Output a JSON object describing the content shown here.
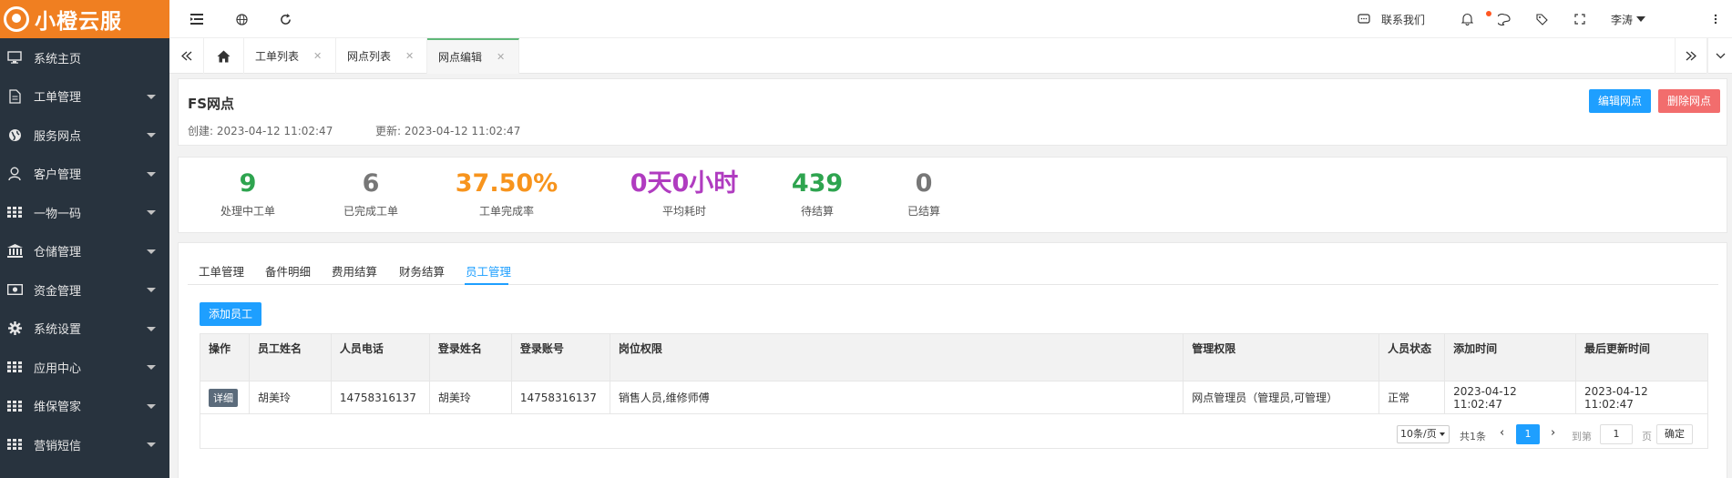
{
  "brand": {
    "name": "小橙云服",
    "color": "#f07f21"
  },
  "sidebar": {
    "items": [
      {
        "label": "系统主页",
        "icon": "monitor-icon",
        "has_caret": false
      },
      {
        "label": "工单管理",
        "icon": "document-icon",
        "has_caret": true
      },
      {
        "label": "服务网点",
        "icon": "globe-icon",
        "has_caret": true
      },
      {
        "label": "客户管理",
        "icon": "user-icon",
        "has_caret": true
      },
      {
        "label": "一物一码",
        "icon": "grid-icon",
        "has_caret": true
      },
      {
        "label": "仓储管理",
        "icon": "bank-icon",
        "has_caret": true
      },
      {
        "label": "资金管理",
        "icon": "money-icon",
        "has_caret": true
      },
      {
        "label": "系统设置",
        "icon": "gear-icon",
        "has_caret": true
      },
      {
        "label": "应用中心",
        "icon": "grid-icon",
        "has_caret": true
      },
      {
        "label": "维保管家",
        "icon": "grid-icon",
        "has_caret": true
      },
      {
        "label": "营销短信",
        "icon": "grid-icon",
        "has_caret": true
      }
    ]
  },
  "topbar": {
    "contact": "联系我们",
    "user": "李涛"
  },
  "tabs": [
    {
      "label": "工单列表"
    },
    {
      "label": "网点列表"
    },
    {
      "label": "网点编辑"
    }
  ],
  "header": {
    "title": "FS网点",
    "created_label": "创建:",
    "created": "2023-04-12 11:02:47",
    "updated_label": "更新:",
    "updated": "2023-04-12 11:02:47",
    "edit_button": "编辑网点",
    "delete_button": "删除网点"
  },
  "stats": [
    {
      "value": "9",
      "label": "处理中工单",
      "color": "#2ea44f"
    },
    {
      "value": "6",
      "label": "已完成工单",
      "color": "#777777"
    },
    {
      "value": "37.50%",
      "label": "工单完成率",
      "color": "#f7941d"
    },
    {
      "value": "0天0小时",
      "label": "平均耗时",
      "color": "#b03cc0"
    },
    {
      "value": "439",
      "label": "待结算",
      "color": "#2ea44f"
    },
    {
      "value": "0",
      "label": "已结算",
      "color": "#777777"
    }
  ],
  "subtabs": [
    "工单管理",
    "备件明细",
    "费用结算",
    "财务结算",
    "员工管理"
  ],
  "add_button": "添加员工",
  "table": {
    "headers": [
      "操作",
      "员工姓名",
      "人员电话",
      "登录姓名",
      "登录账号",
      "岗位权限",
      "管理权限",
      "人员状态",
      "添加时间",
      "最后更新时间"
    ],
    "rows": [
      [
        "详细",
        "胡美玲",
        "14758316137",
        "胡美玲",
        "14758316137",
        "销售人员,维修师傅",
        "网点管理员（管理员,可管理）",
        "正常",
        "2023-04-12 11:02:47",
        "2023-04-12 11:02:47"
      ]
    ]
  },
  "pager": {
    "page_size": "10条/页",
    "total": "共1条",
    "current": "1",
    "goto_label": "到第",
    "goto_value": "1",
    "page_unit": "页",
    "confirm": "确定"
  }
}
